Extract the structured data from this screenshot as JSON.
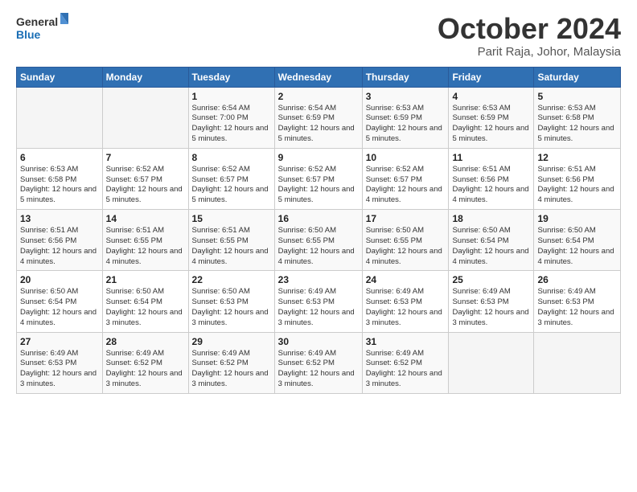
{
  "logo": {
    "line1": "General",
    "line2": "Blue"
  },
  "header": {
    "month": "October 2024",
    "location": "Parit Raja, Johor, Malaysia"
  },
  "weekdays": [
    "Sunday",
    "Monday",
    "Tuesday",
    "Wednesday",
    "Thursday",
    "Friday",
    "Saturday"
  ],
  "weeks": [
    [
      {
        "day": "",
        "info": ""
      },
      {
        "day": "",
        "info": ""
      },
      {
        "day": "1",
        "info": "Sunrise: 6:54 AM\nSunset: 7:00 PM\nDaylight: 12 hours and 5 minutes."
      },
      {
        "day": "2",
        "info": "Sunrise: 6:54 AM\nSunset: 6:59 PM\nDaylight: 12 hours and 5 minutes."
      },
      {
        "day": "3",
        "info": "Sunrise: 6:53 AM\nSunset: 6:59 PM\nDaylight: 12 hours and 5 minutes."
      },
      {
        "day": "4",
        "info": "Sunrise: 6:53 AM\nSunset: 6:59 PM\nDaylight: 12 hours and 5 minutes."
      },
      {
        "day": "5",
        "info": "Sunrise: 6:53 AM\nSunset: 6:58 PM\nDaylight: 12 hours and 5 minutes."
      }
    ],
    [
      {
        "day": "6",
        "info": "Sunrise: 6:53 AM\nSunset: 6:58 PM\nDaylight: 12 hours and 5 minutes."
      },
      {
        "day": "7",
        "info": "Sunrise: 6:52 AM\nSunset: 6:57 PM\nDaylight: 12 hours and 5 minutes."
      },
      {
        "day": "8",
        "info": "Sunrise: 6:52 AM\nSunset: 6:57 PM\nDaylight: 12 hours and 5 minutes."
      },
      {
        "day": "9",
        "info": "Sunrise: 6:52 AM\nSunset: 6:57 PM\nDaylight: 12 hours and 5 minutes."
      },
      {
        "day": "10",
        "info": "Sunrise: 6:52 AM\nSunset: 6:57 PM\nDaylight: 12 hours and 4 minutes."
      },
      {
        "day": "11",
        "info": "Sunrise: 6:51 AM\nSunset: 6:56 PM\nDaylight: 12 hours and 4 minutes."
      },
      {
        "day": "12",
        "info": "Sunrise: 6:51 AM\nSunset: 6:56 PM\nDaylight: 12 hours and 4 minutes."
      }
    ],
    [
      {
        "day": "13",
        "info": "Sunrise: 6:51 AM\nSunset: 6:56 PM\nDaylight: 12 hours and 4 minutes."
      },
      {
        "day": "14",
        "info": "Sunrise: 6:51 AM\nSunset: 6:55 PM\nDaylight: 12 hours and 4 minutes."
      },
      {
        "day": "15",
        "info": "Sunrise: 6:51 AM\nSunset: 6:55 PM\nDaylight: 12 hours and 4 minutes."
      },
      {
        "day": "16",
        "info": "Sunrise: 6:50 AM\nSunset: 6:55 PM\nDaylight: 12 hours and 4 minutes."
      },
      {
        "day": "17",
        "info": "Sunrise: 6:50 AM\nSunset: 6:55 PM\nDaylight: 12 hours and 4 minutes."
      },
      {
        "day": "18",
        "info": "Sunrise: 6:50 AM\nSunset: 6:54 PM\nDaylight: 12 hours and 4 minutes."
      },
      {
        "day": "19",
        "info": "Sunrise: 6:50 AM\nSunset: 6:54 PM\nDaylight: 12 hours and 4 minutes."
      }
    ],
    [
      {
        "day": "20",
        "info": "Sunrise: 6:50 AM\nSunset: 6:54 PM\nDaylight: 12 hours and 4 minutes."
      },
      {
        "day": "21",
        "info": "Sunrise: 6:50 AM\nSunset: 6:54 PM\nDaylight: 12 hours and 3 minutes."
      },
      {
        "day": "22",
        "info": "Sunrise: 6:50 AM\nSunset: 6:53 PM\nDaylight: 12 hours and 3 minutes."
      },
      {
        "day": "23",
        "info": "Sunrise: 6:49 AM\nSunset: 6:53 PM\nDaylight: 12 hours and 3 minutes."
      },
      {
        "day": "24",
        "info": "Sunrise: 6:49 AM\nSunset: 6:53 PM\nDaylight: 12 hours and 3 minutes."
      },
      {
        "day": "25",
        "info": "Sunrise: 6:49 AM\nSunset: 6:53 PM\nDaylight: 12 hours and 3 minutes."
      },
      {
        "day": "26",
        "info": "Sunrise: 6:49 AM\nSunset: 6:53 PM\nDaylight: 12 hours and 3 minutes."
      }
    ],
    [
      {
        "day": "27",
        "info": "Sunrise: 6:49 AM\nSunset: 6:53 PM\nDaylight: 12 hours and 3 minutes."
      },
      {
        "day": "28",
        "info": "Sunrise: 6:49 AM\nSunset: 6:52 PM\nDaylight: 12 hours and 3 minutes."
      },
      {
        "day": "29",
        "info": "Sunrise: 6:49 AM\nSunset: 6:52 PM\nDaylight: 12 hours and 3 minutes."
      },
      {
        "day": "30",
        "info": "Sunrise: 6:49 AM\nSunset: 6:52 PM\nDaylight: 12 hours and 3 minutes."
      },
      {
        "day": "31",
        "info": "Sunrise: 6:49 AM\nSunset: 6:52 PM\nDaylight: 12 hours and 3 minutes."
      },
      {
        "day": "",
        "info": ""
      },
      {
        "day": "",
        "info": ""
      }
    ]
  ]
}
